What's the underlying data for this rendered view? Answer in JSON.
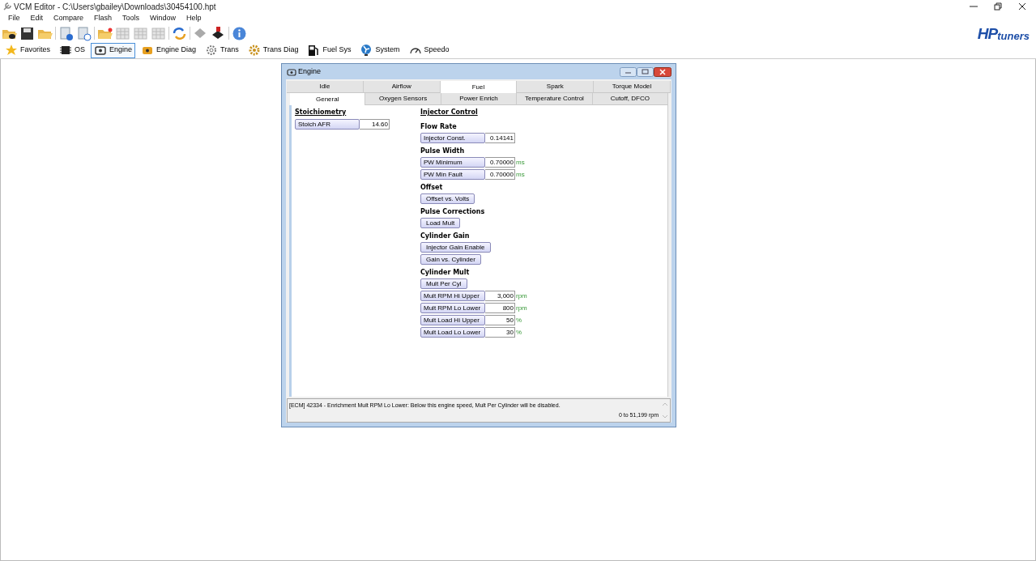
{
  "window": {
    "title": "VCM Editor - C:\\Users\\gbailey\\Downloads\\30454100.hpt"
  },
  "menu": [
    "File",
    "Edit",
    "Compare",
    "Flash",
    "Tools",
    "Window",
    "Help"
  ],
  "logo": {
    "mark": "HP",
    "word": "tuners"
  },
  "nav": [
    {
      "label": "Favorites",
      "selected": false
    },
    {
      "label": "OS",
      "selected": false
    },
    {
      "label": "Engine",
      "selected": true
    },
    {
      "label": "Engine Diag",
      "selected": false
    },
    {
      "label": "Trans",
      "selected": false
    },
    {
      "label": "Trans Diag",
      "selected": false
    },
    {
      "label": "Fuel Sys",
      "selected": false
    },
    {
      "label": "System",
      "selected": false
    },
    {
      "label": "Speedo",
      "selected": false
    }
  ],
  "editor": {
    "title": "Engine",
    "tabs": [
      {
        "label": "Idle",
        "selected": false
      },
      {
        "label": "Airflow",
        "selected": false
      },
      {
        "label": "Fuel",
        "selected": true
      },
      {
        "label": "Spark",
        "selected": false
      },
      {
        "label": "Torque Model",
        "selected": false
      }
    ],
    "subtabs": [
      {
        "label": "General",
        "selected": true
      },
      {
        "label": "Oxygen Sensors",
        "selected": false
      },
      {
        "label": "Power Enrich",
        "selected": false
      },
      {
        "label": "Temperature Control",
        "selected": false
      },
      {
        "label": "Cutoff, DFCO",
        "selected": false
      }
    ],
    "left": {
      "heading": "Stoichiometry",
      "items": [
        {
          "kind": "param",
          "label": "Stoich AFR",
          "value": "14.60"
        }
      ]
    },
    "right": {
      "heading": "Injector Control",
      "groups": [
        {
          "title": "Flow Rate",
          "items": [
            {
              "kind": "param",
              "label": "Injector Const.",
              "value": "0.14141"
            }
          ]
        },
        {
          "title": "Pulse Width",
          "items": [
            {
              "kind": "param",
              "label": "PW Minimum",
              "value": "0.70000",
              "unit": "ms"
            },
            {
              "kind": "param",
              "label": "PW Min Fault",
              "value": "0.70000",
              "unit": "ms"
            }
          ]
        },
        {
          "title": "Offset",
          "items": [
            {
              "kind": "button",
              "label": "Offset vs. Volts"
            }
          ]
        },
        {
          "title": "Pulse Corrections",
          "items": [
            {
              "kind": "button",
              "label": "Load Mult"
            }
          ]
        },
        {
          "title": "Cylinder Gain",
          "items": [
            {
              "kind": "button",
              "label": "Injector Gain Enable"
            },
            {
              "kind": "button",
              "label": "Gain vs. Cylinder"
            }
          ]
        },
        {
          "title": "Cylinder Mult",
          "items": [
            {
              "kind": "button",
              "label": "Mult Per Cyl"
            },
            {
              "kind": "param",
              "label": "Mult RPM Hi Upper",
              "value": "3,000",
              "unit": "rpm"
            },
            {
              "kind": "param",
              "label": "Mult RPM Lo Lower",
              "value": "800",
              "unit": "rpm"
            },
            {
              "kind": "param",
              "label": "Mult Load Hi Upper",
              "value": "50",
              "unit": "%"
            },
            {
              "kind": "param",
              "label": "Mult Load Lo Lower",
              "value": "30",
              "unit": "%"
            }
          ]
        }
      ]
    },
    "info": {
      "description": "[ECM] 42334 - Enrichment Mult RPM Lo Lower: Below this engine speed, Mult Per Cylinder will be disabled.",
      "range": "0 to 51,199 rpm"
    }
  }
}
